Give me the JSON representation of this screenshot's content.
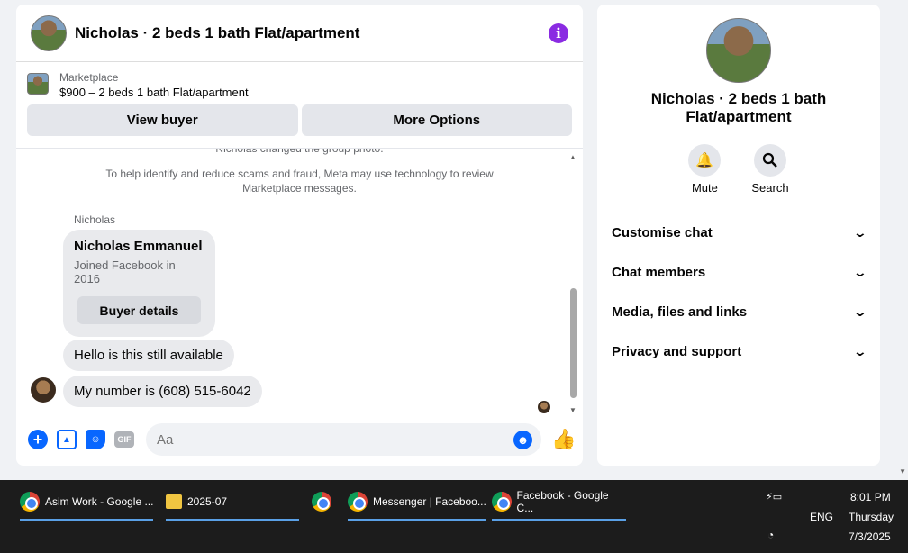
{
  "chat": {
    "title": "Nicholas · 2 beds 1 bath Flat/apartment",
    "marketplace_label": "Marketplace",
    "listing": "$900 – 2 beds 1 bath Flat/apartment",
    "view_buyer": "View buyer",
    "more_options": "More Options",
    "group_photo_note": "Nicholas changed the group photo.",
    "scam_note": "To help identify and reduce scams and fraud, Meta may use technology to review Marketplace messages.",
    "sender": "Nicholas",
    "buyer_card": {
      "name": "Nicholas Emmanuel",
      "joined": "Joined Facebook in 2016",
      "button": "Buyer details"
    },
    "messages": [
      "Hello is this still available",
      "My number is (608) 515-6042"
    ],
    "composer_placeholder": "Aa"
  },
  "info_panel": {
    "title": "Nicholas · 2 beds 1 bath Flat/apartment",
    "actions": [
      {
        "label": "Mute",
        "icon": "bell-icon"
      },
      {
        "label": "Search",
        "icon": "search-icon"
      }
    ],
    "sections": [
      "Customise chat",
      "Chat members",
      "Media, files and links",
      "Privacy and support"
    ]
  },
  "taskbar": {
    "tasks": [
      {
        "label": "Asim Work - Google ...",
        "icon": "chrome-icon"
      },
      {
        "label": "2025-07",
        "icon": "folder-icon"
      },
      {
        "label": "",
        "icon": "app-icon"
      },
      {
        "label": "Messenger | Faceboo...",
        "icon": "chrome-icon"
      },
      {
        "label": "Facebook - Google C...",
        "icon": "chrome-icon"
      }
    ],
    "lang": "ENG",
    "time": "8:01 PM",
    "day": "Thursday",
    "date": "7/3/2025"
  },
  "colors": {
    "accent": "#0866ff",
    "info_icon": "#8a2be2",
    "bubble": "#e9eaed",
    "taskbar": "#1c1c1c"
  }
}
